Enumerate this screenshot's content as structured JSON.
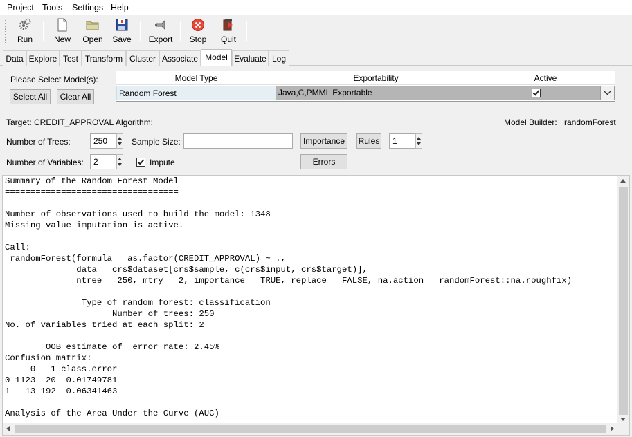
{
  "menu": [
    "Project",
    "Tools",
    "Settings",
    "Help"
  ],
  "toolbar": {
    "run": "Run",
    "new": "New",
    "open": "Open",
    "save": "Save",
    "export": "Export",
    "stop": "Stop",
    "quit": "Quit"
  },
  "tabs": [
    "Data",
    "Explore",
    "Test",
    "Transform",
    "Cluster",
    "Associate",
    "Model",
    "Evaluate",
    "Log"
  ],
  "active_tab": "Model",
  "models": {
    "prompt": "Please Select Model(s):",
    "select_all": "Select All",
    "clear_all": "Clear All",
    "columns": [
      "Model Type",
      "Exportability",
      "Active"
    ],
    "row": {
      "type": "Random Forest",
      "export": "Java,C,PMML Exportable",
      "active": true
    }
  },
  "info": {
    "target": "Target: CREDIT_APPROVAL",
    "algorithm": "Algorithm:",
    "builder_label": "Model Builder:",
    "builder_value": "randomForest"
  },
  "params": {
    "trees_label": "Number of Trees:",
    "trees_value": "250",
    "sample_label": "Sample Size:",
    "sample_value": "",
    "importance": "Importance",
    "rules": "Rules",
    "rules_value": "1",
    "vars_label": "Number of Variables:",
    "vars_value": "2",
    "impute_label": "Impute",
    "impute_checked": true,
    "errors": "Errors"
  },
  "output_lines": [
    "Summary of the Random Forest Model",
    "==================================",
    "",
    "Number of observations used to build the model: 1348",
    "Missing value imputation is active.",
    "",
    "Call:",
    " randomForest(formula = as.factor(CREDIT_APPROVAL) ~ .,",
    "              data = crs$dataset[crs$sample, c(crs$input, crs$target)],",
    "              ntree = 250, mtry = 2, importance = TRUE, replace = FALSE, na.action = randomForest::na.roughfix)",
    "",
    "               Type of random forest: classification",
    "                     Number of trees: 250",
    "No. of variables tried at each split: 2",
    "",
    "        OOB estimate of  error rate: 2.45%",
    "Confusion matrix:",
    "     0   1 class.error",
    "0 1123  20  0.01749781",
    "1   13 192  0.06341463",
    "",
    "Analysis of the Area Under the Curve (AUC)"
  ]
}
